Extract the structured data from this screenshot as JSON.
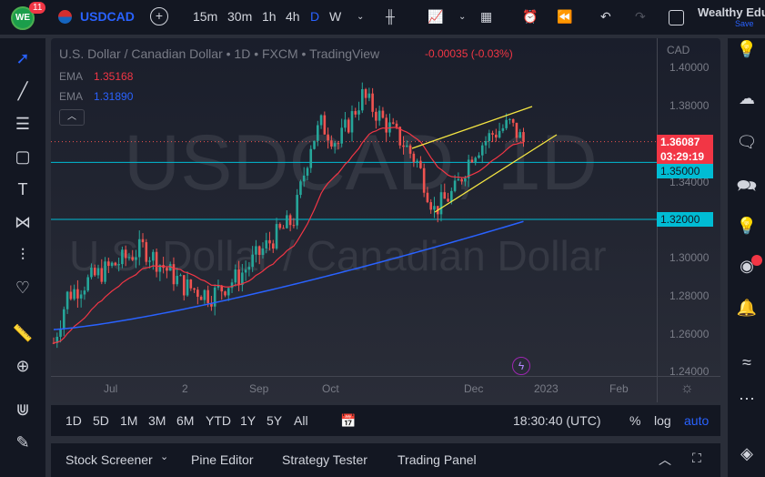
{
  "top": {
    "notif_count": "11",
    "symbol": "USDCAD",
    "intervals": [
      "15m",
      "30m",
      "1h",
      "4h",
      "D",
      "W"
    ],
    "active_interval": "D",
    "layout_name": "Wealthy Edu",
    "save_label": "Save"
  },
  "chart": {
    "title": "U.S. Dollar / Canadian Dollar • 1D • FXCM • TradingView",
    "change": "-0.00035 (-0.03%)",
    "ema1_label": "EMA",
    "ema1_value": "1.35168",
    "ema2_label": "EMA",
    "ema2_value": "1.31890",
    "watermark1": "USDCAD, 1D",
    "watermark2": "U.S. Dollar / Canadian Dollar",
    "currency": "CAD",
    "price_ticks": [
      "1.40000",
      "1.38000",
      "1.34000",
      "1.30000",
      "1.28000",
      "1.26000",
      "1.24000"
    ],
    "last_price": "1.36087",
    "countdown": "03:29:19",
    "level1": "1.35000",
    "level2": "1.32000",
    "date_ticks": [
      "Jul",
      "2",
      "Sep",
      "Oct",
      "Dec",
      "2023",
      "Feb"
    ],
    "colors": {
      "up": "#26a69a",
      "down": "#ef5350",
      "ema1": "#f23645",
      "ema2": "#2962ff",
      "level": "#00bcd4",
      "trend": "#f5e642"
    },
    "path": [
      [
        0,
        1.255
      ],
      [
        4,
        1.28
      ],
      [
        12,
        1.29
      ],
      [
        26,
        1.305
      ],
      [
        38,
        1.285
      ],
      [
        46,
        1.28
      ],
      [
        54,
        1.29
      ],
      [
        64,
        1.31
      ],
      [
        70,
        1.32
      ],
      [
        75,
        1.36
      ],
      [
        78,
        1.37
      ],
      [
        83,
        1.36
      ],
      [
        90,
        1.385
      ],
      [
        97,
        1.37
      ],
      [
        102,
        1.36
      ],
      [
        106,
        1.35
      ],
      [
        111,
        1.325
      ],
      [
        117,
        1.335
      ],
      [
        122,
        1.355
      ],
      [
        128,
        1.365
      ],
      [
        133,
        1.37
      ],
      [
        137,
        1.361
      ]
    ]
  },
  "bottom": {
    "ranges": [
      "1D",
      "5D",
      "1M",
      "3M",
      "6M",
      "YTD",
      "1Y",
      "5Y",
      "All"
    ],
    "time": "18:30:40 (UTC)",
    "pct": "%",
    "log": "log",
    "auto": "auto",
    "tabs": [
      "Stock Screener",
      "Pine Editor",
      "Strategy Tester",
      "Trading Panel"
    ]
  }
}
